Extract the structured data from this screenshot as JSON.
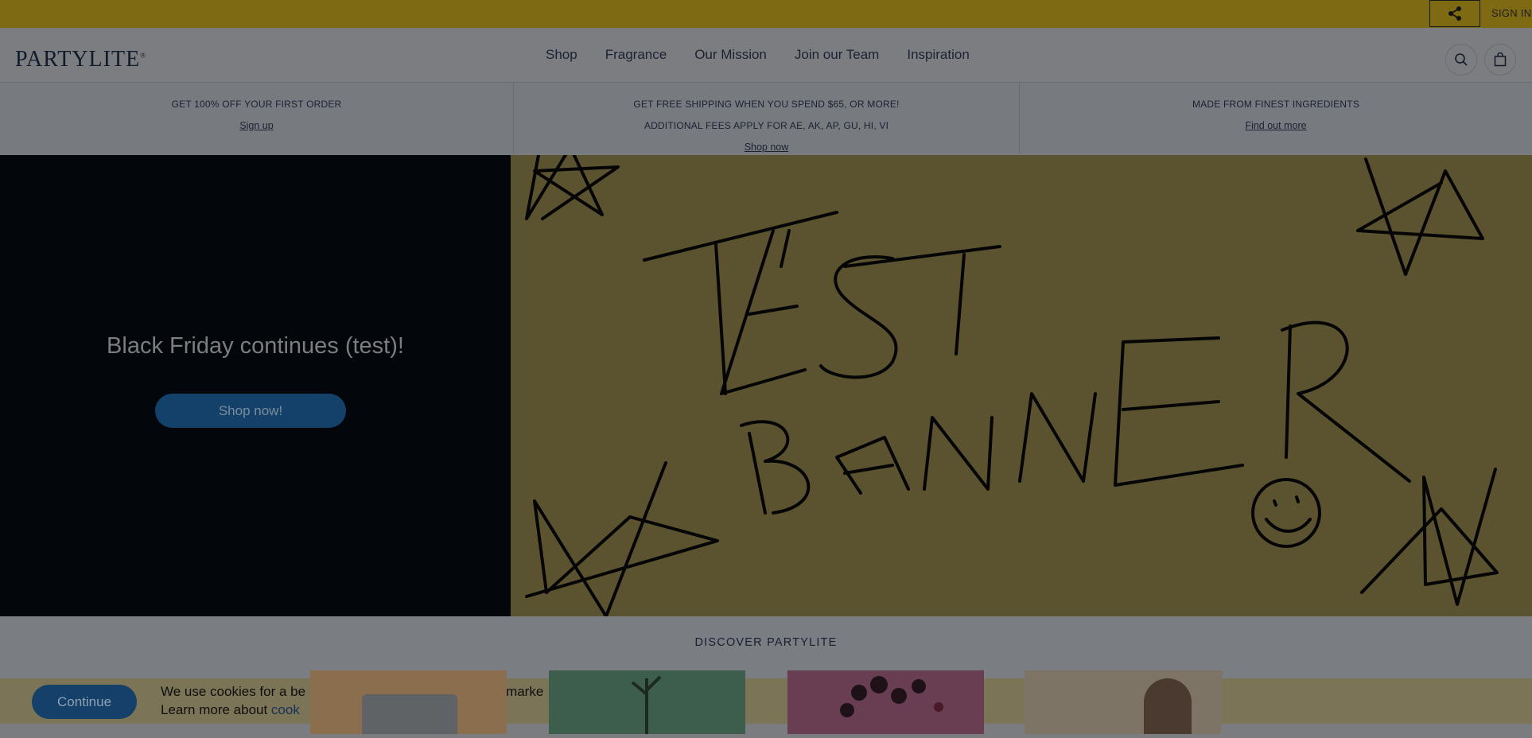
{
  "topbar": {
    "signin_label": "SIGN IN",
    "share_icon": "share-icon"
  },
  "header": {
    "logo_text": "PARTYLITE",
    "nav": [
      "Shop",
      "Fragrance",
      "Our Mission",
      "Join our Team",
      "Inspiration"
    ],
    "search_icon": "search-icon",
    "bag_icon": "shopping-bag-icon"
  },
  "promo": [
    {
      "lines": [
        "GET 100% OFF YOUR FIRST ORDER"
      ],
      "link": "Sign up"
    },
    {
      "lines": [
        "GET FREE SHIPPING WHEN YOU SPEND $65, OR MORE!",
        "ADDITIONAL FEES APPLY FOR AE, AK, AP, GU, HI, VI"
      ],
      "link": "Shop now"
    },
    {
      "lines": [
        "MADE FROM FINEST INGREDIENTS"
      ],
      "link": "Find out more"
    }
  ],
  "hero": {
    "title": "Black Friday continues (test)!",
    "button": "Shop now!",
    "banner_text": "TEST BANNER"
  },
  "discover": {
    "title": "DISCOVER PARTYLITE"
  },
  "cookie": {
    "button": "Continue",
    "text_line1": "We use cookies for a be",
    "text_line1_end": "marke",
    "text_line2": "Learn more about ",
    "link_fragment": "cook"
  },
  "colors": {
    "topbar": "#7f6a14",
    "hero_left": "#03060b",
    "hero_right": "#5b5230",
    "button": "#14416a"
  }
}
